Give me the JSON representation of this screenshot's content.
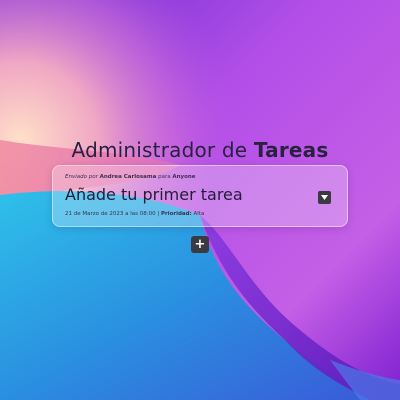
{
  "header": {
    "title_prefix": "Administrador de ",
    "title_emphasis": "Tareas"
  },
  "task": {
    "meta_sent_by": "Enviado por ",
    "meta_author": "Andrea Carlosama",
    "meta_for": " para ",
    "meta_recipient": "Anyone",
    "title": "Añade tu primer tarea",
    "date": "21 de Marzo de 2023 a las 08:00",
    "separator": " | ",
    "priority_label": "Prioridad:",
    "priority_value": " Alta"
  },
  "controls": {
    "add_symbol": "+",
    "dropdown_icon": "chevron-down-icon"
  },
  "theme": {
    "button_bg": "#3b3a42",
    "title_color": "#2a2140"
  }
}
